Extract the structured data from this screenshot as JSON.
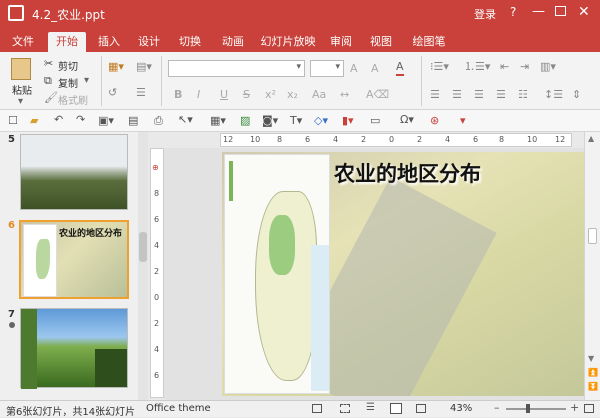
{
  "window": {
    "title": "4.2_农业.ppt",
    "login": "登录",
    "colors": {
      "brand": "#c9413a",
      "accent_orange": "#f0a030"
    }
  },
  "tabs": [
    "文件",
    "开始",
    "插入",
    "设计",
    "切换",
    "动画",
    "幻灯片放映",
    "审阅",
    "视图",
    "绘图笔"
  ],
  "ribbon": {
    "paste": "粘贴",
    "cut": "剪切",
    "copy": "复制",
    "format_painter": "格式刷"
  },
  "slides": {
    "thumb5_num": "5",
    "thumb6_num": "6",
    "thumb6_title": "农业的地区分布",
    "thumb7_num": "7"
  },
  "ruler": {
    "h_labels": [
      "12",
      "10",
      "8",
      "6",
      "4",
      "2",
      "0",
      "2",
      "4",
      "6",
      "8",
      "10",
      "12"
    ],
    "v_labels": [
      "8",
      "6",
      "4",
      "2",
      "0",
      "2",
      "4",
      "6"
    ]
  },
  "slide": {
    "title": "农业的地区分布"
  },
  "status": {
    "slide_info": "第6张幻灯片，共14张幻灯片",
    "theme": "Office theme",
    "zoom": "43%"
  }
}
